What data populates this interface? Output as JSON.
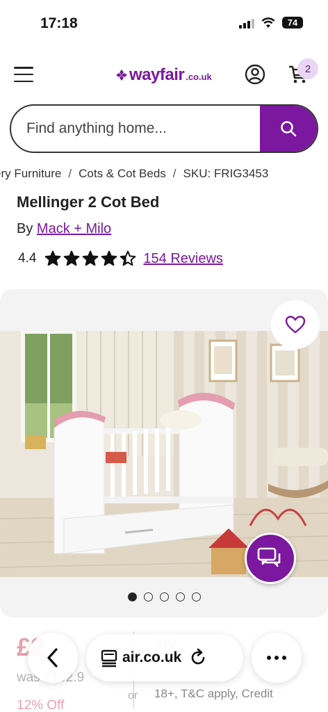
{
  "status_bar": {
    "time": "17:18",
    "battery": "74"
  },
  "header": {
    "logo_word": "wayfair",
    "logo_domain": ".co.uk",
    "cart_count": "2",
    "icons": [
      "menu-icon",
      "account-icon",
      "cart-icon"
    ]
  },
  "search": {
    "placeholder": "Find anything home..."
  },
  "breadcrumb": {
    "items": [
      "ery Furniture",
      "Cots & Cot Beds",
      "SKU: FRIG3453"
    ],
    "separator": "/"
  },
  "product": {
    "title": "Mellinger 2 Cot Bed",
    "by_prefix": "By",
    "brand": "Mack + Milo",
    "rating": "4.4",
    "rating_value": 4.4,
    "rating_max": 5,
    "reviews_link": "154 Reviews"
  },
  "gallery": {
    "image_count": 5,
    "active_index": 0
  },
  "pricing": {
    "price_now": "£2",
    "was_prefix": "was £192.9",
    "discount": "12% Off",
    "promo_or": "or",
    "promo_line_1": "ero",
    "promo_line_2": "18+, T&C apply, Credit"
  },
  "browser_toolbar": {
    "url": "air.co.uk"
  },
  "colors": {
    "brand": "#7b189f",
    "sale": "#c7314e",
    "badge_bg": "#e8d6f3"
  }
}
